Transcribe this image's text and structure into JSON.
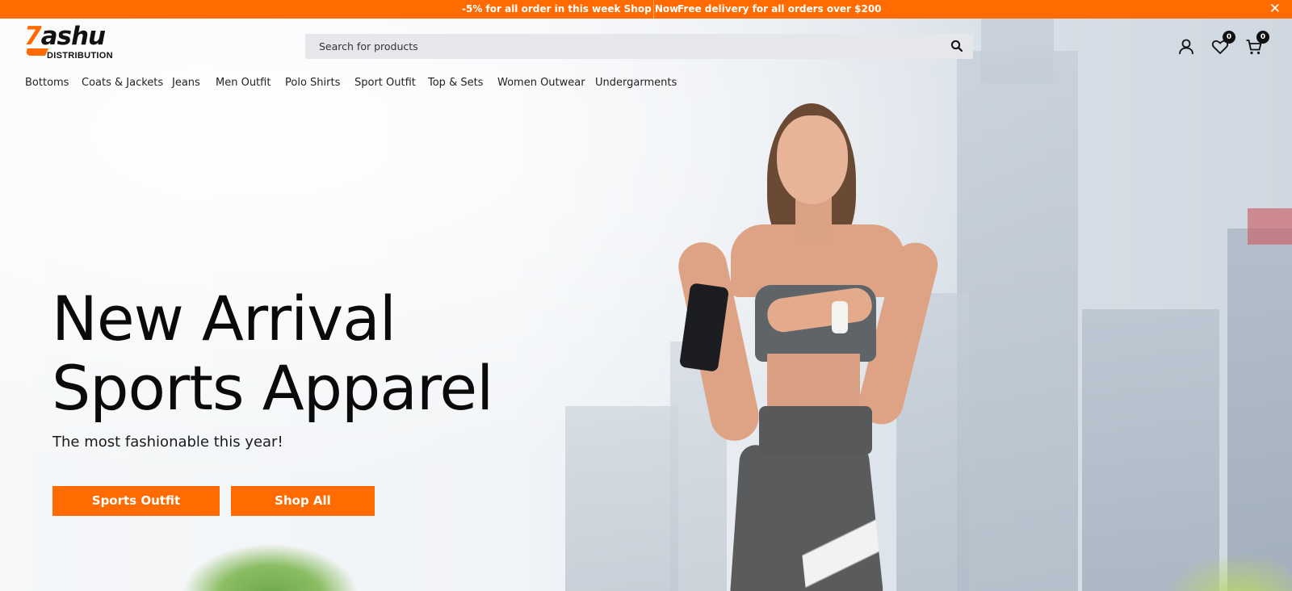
{
  "announcement": {
    "promo": "-5% for all order in this week Shop Now",
    "delivery": "Free delivery for all orders over $200",
    "close_glyph": "✕"
  },
  "logo": {
    "seven": "7",
    "word": "ashu",
    "sub": "DISTRIBUTION",
    "accent_color": "#ff6b00"
  },
  "search": {
    "placeholder": "Search for products",
    "button_icon": "search-icon"
  },
  "header_icons": {
    "account_icon": "user-icon",
    "wishlist_icon": "heart-icon",
    "wishlist_count": "0",
    "cart_icon": "cart-icon",
    "cart_count": "0"
  },
  "nav": {
    "items": [
      {
        "label": "Bottoms"
      },
      {
        "label": "Coats & Jackets"
      },
      {
        "label": "Jeans"
      },
      {
        "label": "Men Outfit"
      },
      {
        "label": "Polo Shirts"
      },
      {
        "label": "Sport Outfit"
      },
      {
        "label": "Top & Sets"
      },
      {
        "label": "Women Outwear"
      },
      {
        "label": "Undergarments"
      }
    ]
  },
  "hero": {
    "headline_line1": "New Arrival",
    "headline_line2": "Sports Apparel",
    "subheadline": "The most fashionable this year!",
    "cta_primary": "Sports Outfit",
    "cta_secondary": "Shop All",
    "button_color": "#ff6b00"
  }
}
